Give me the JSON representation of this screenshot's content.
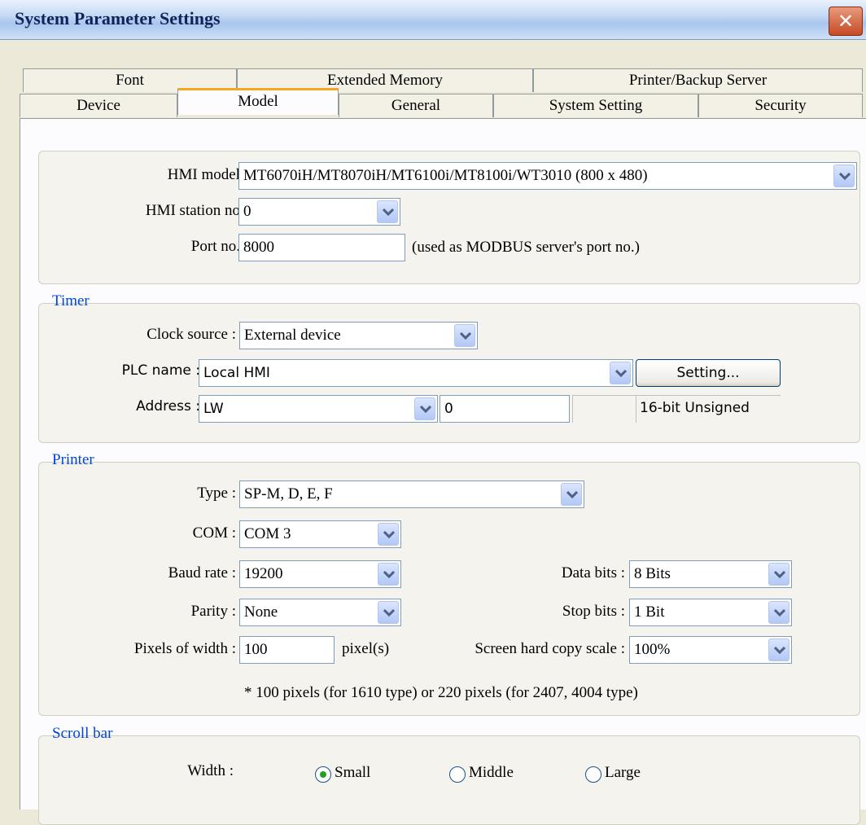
{
  "window": {
    "title": "System Parameter Settings",
    "close_glyph": "✕"
  },
  "tabs": {
    "back_row": [
      "Font",
      "Extended Memory",
      "Printer/Backup Server"
    ],
    "front_row": [
      "Device",
      "Model",
      "General",
      "System Setting",
      "Security"
    ],
    "active": "Model"
  },
  "model": {
    "hmi_model_label": "HMI model :",
    "hmi_model_value": "MT6070iH/MT8070iH/MT6100i/MT8100i/WT3010 (800 x 480)",
    "station_label": "HMI station no :",
    "station_value": "0",
    "port_label": "Port no. :",
    "port_value": "8000",
    "port_note": "(used as MODBUS server's port no.)"
  },
  "timer": {
    "legend": "Timer",
    "clock_label": "Clock source :",
    "clock_value": "External device",
    "plc_label": "PLC name :",
    "plc_value": "Local HMI",
    "setting_button": "Setting...",
    "address_label": "Address :",
    "address_device": "LW",
    "address_value": "0",
    "address_type": "16-bit Unsigned"
  },
  "printer": {
    "legend": "Printer",
    "type_label": "Type :",
    "type_value": "SP-M, D, E, F",
    "com_label": "COM :",
    "com_value": "COM 3",
    "baud_label": "Baud rate :",
    "baud_value": "19200",
    "databits_label": "Data bits :",
    "databits_value": "8 Bits",
    "parity_label": "Parity :",
    "parity_value": "None",
    "stopbits_label": "Stop bits :",
    "stopbits_value": "1 Bit",
    "pixels_label": "Pixels of width :",
    "pixels_value": "100",
    "pixels_unit": "pixel(s)",
    "scale_label": "Screen hard copy scale :",
    "scale_value": "100%",
    "note": "* 100 pixels (for 1610 type) or 220 pixels (for 2407, 4004 type)"
  },
  "scrollbar": {
    "legend": "Scroll bar",
    "width_label": "Width :",
    "options": [
      "Small",
      "Middle",
      "Large"
    ],
    "selected": "Small"
  },
  "icons": {
    "dropdown": "chevron-down-icon",
    "close": "close-icon",
    "radio": "radio-icon"
  },
  "colors": {
    "tab_active_accent": "#f5a623",
    "legend_text": "#0046d5",
    "radio_dot": "#21a121"
  }
}
